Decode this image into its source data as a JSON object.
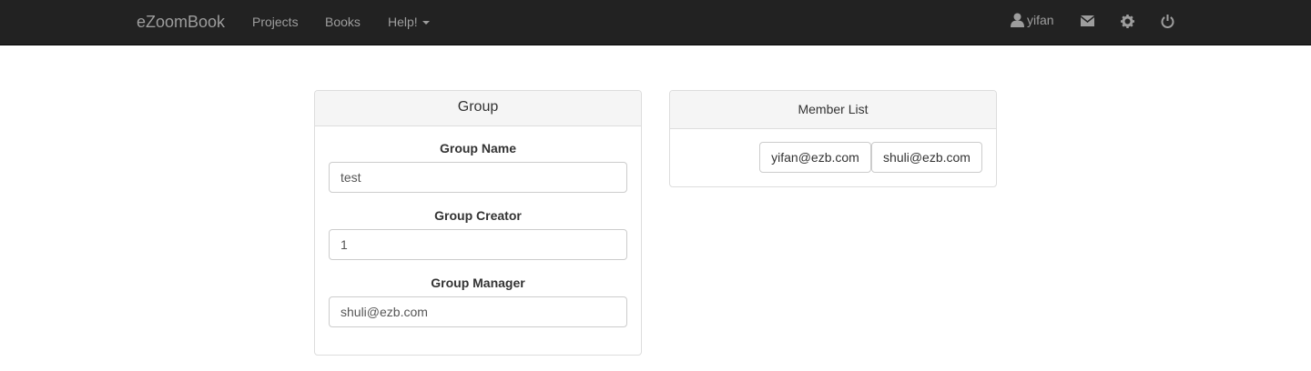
{
  "navbar": {
    "brand": "eZoomBook",
    "links": [
      {
        "label": "Projects"
      },
      {
        "label": "Books"
      },
      {
        "label": "Help!"
      }
    ],
    "user": {
      "name": "yifan",
      "icon": "user-icon"
    },
    "icons": [
      "envelope-icon",
      "gear-icon",
      "power-icon"
    ]
  },
  "group_panel": {
    "heading": "Group",
    "fields": [
      {
        "label": "Group Name",
        "value": "test"
      },
      {
        "label": "Group Creator",
        "value": "1"
      },
      {
        "label": "Group Manager",
        "value": "shuli@ezb.com"
      }
    ]
  },
  "member_panel": {
    "heading": "Member List",
    "members": [
      "yifan@ezb.com",
      "shuli@ezb.com"
    ]
  }
}
